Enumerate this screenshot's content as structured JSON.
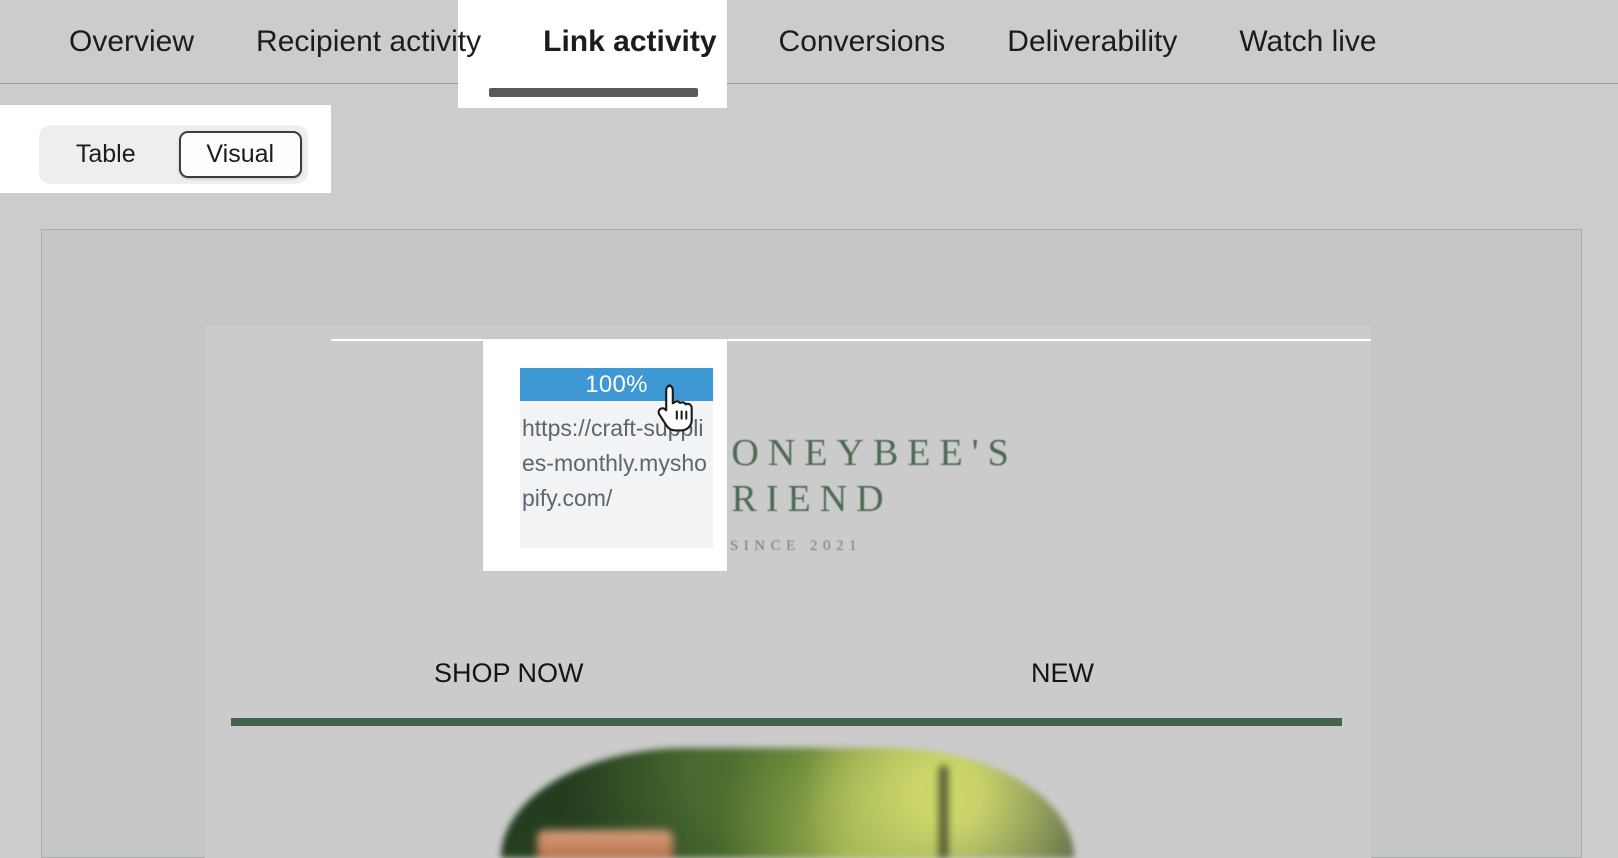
{
  "tabs": [
    {
      "label": "Overview",
      "active": false
    },
    {
      "label": "Recipient activity",
      "active": false
    },
    {
      "label": "Link activity",
      "active": true
    },
    {
      "label": "Conversions",
      "active": false
    },
    {
      "label": "Deliverability",
      "active": false
    },
    {
      "label": "Watch live",
      "active": false
    }
  ],
  "view_toggle": {
    "options": [
      "Table",
      "Visual"
    ],
    "table_label": "Table",
    "visual_label": "Visual",
    "selected": "Visual"
  },
  "tooltip": {
    "percent": "100%",
    "url": "https://craft-supplies-monthly.myshopify.com/",
    "header_color": "#3d98d4",
    "body_color": "#f2f3f4",
    "text_color": "#5b6672"
  },
  "email_preview": {
    "logo": {
      "line1": "E HONEYBEE'S",
      "line2": "FRIEND",
      "tagline": "SINCE 2021",
      "color": "#4d6a52"
    },
    "nav": [
      {
        "label": "SHOP NOW"
      },
      {
        "label": "NEW"
      }
    ],
    "divider_color": "#44634b",
    "hero_alt": "blurred garden photo with terracotta pot"
  },
  "theme": {
    "page_background": "#cccccc",
    "card_background": "#c5c6c6",
    "card_border": "#a8adb2",
    "active_tab_background": "#ffffff",
    "active_tab_underline": "#5a5a5c",
    "segment_track": "#eeeeef",
    "segment_selected_border": "#3c3c3e",
    "accent_blue": "#3d98d4"
  },
  "cursor": {
    "type": "pointing-hand-cursor"
  }
}
